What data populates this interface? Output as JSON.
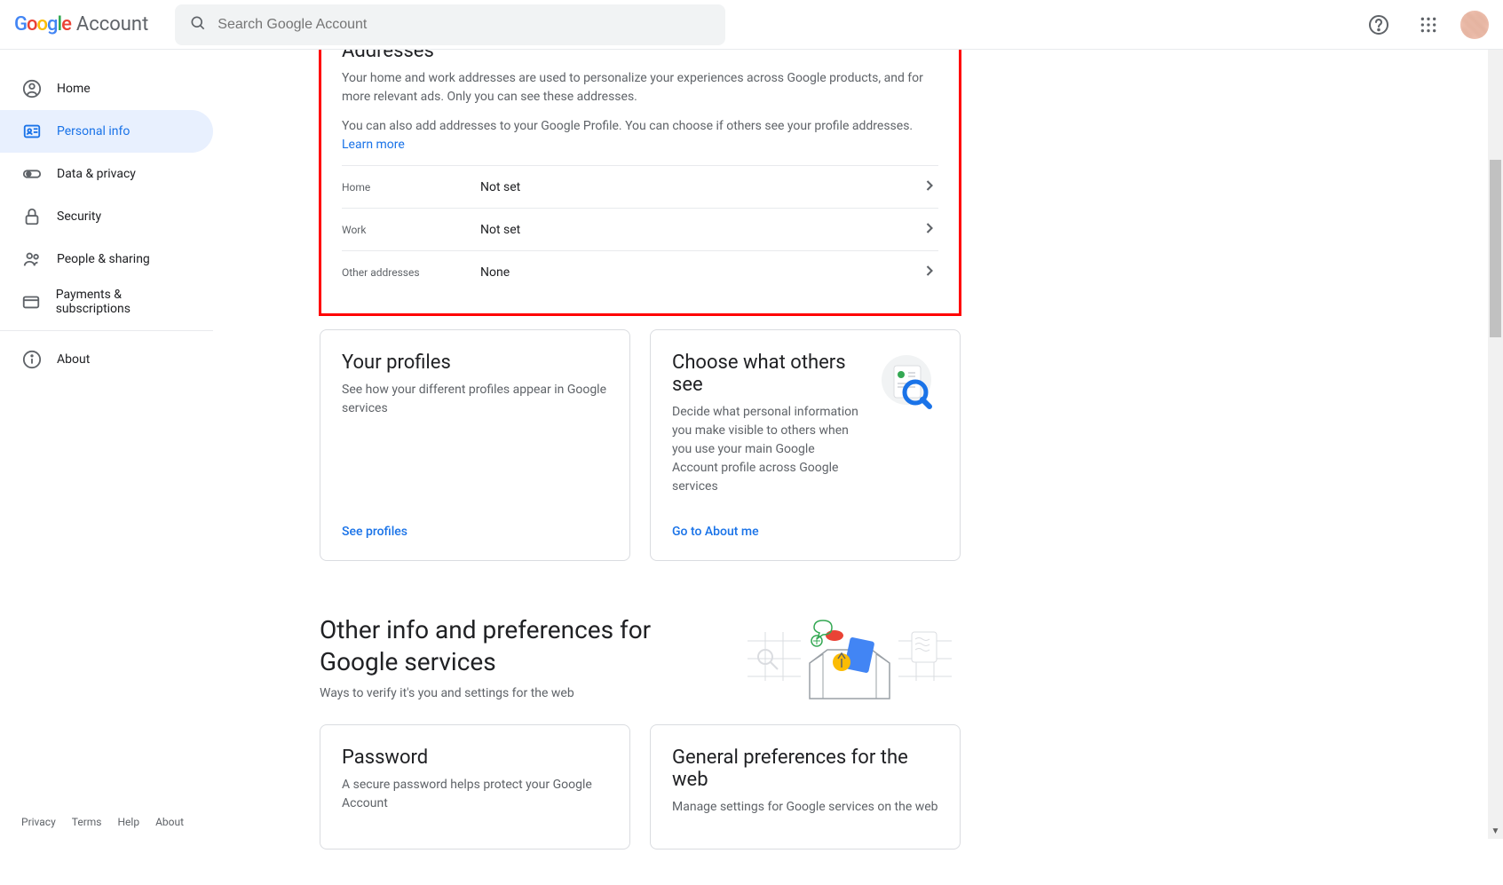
{
  "header": {
    "logo_brand": "Google",
    "logo_product": "Account",
    "search_placeholder": "Search Google Account"
  },
  "sidebar": {
    "items": [
      {
        "label": "Home"
      },
      {
        "label": "Personal info"
      },
      {
        "label": "Data & privacy"
      },
      {
        "label": "Security"
      },
      {
        "label": "People & sharing"
      },
      {
        "label": "Payments & subscriptions"
      },
      {
        "label": "About"
      }
    ]
  },
  "footer": {
    "links": [
      "Privacy",
      "Terms",
      "Help",
      "About"
    ]
  },
  "addresses_card": {
    "title": "Addresses",
    "desc1": "Your home and work addresses are used to personalize your experiences across Google products, and for more relevant ads. Only you can see these addresses.",
    "desc2": "You can also add addresses to your Google Profile. You can choose if others see your profile addresses. ",
    "learn_more": "Learn more",
    "rows": [
      {
        "label": "Home",
        "value": "Not set"
      },
      {
        "label": "Work",
        "value": "Not set"
      },
      {
        "label": "Other addresses",
        "value": "None"
      }
    ]
  },
  "profiles_card": {
    "title": "Your profiles",
    "desc": "See how your different profiles appear in Google services",
    "link": "See profiles"
  },
  "others_card": {
    "title": "Choose what others see",
    "desc": "Decide what personal information you make visible to others when you use your main Google Account profile across Google services",
    "link": "Go to About me"
  },
  "other_info_section": {
    "title": "Other info and preferences for Google services",
    "subtitle": "Ways to verify it's you and settings for the web"
  },
  "password_card": {
    "title": "Password",
    "desc": "A secure password helps protect your Google Account"
  },
  "general_prefs_card": {
    "title": "General preferences for the web",
    "desc": "Manage settings for Google services on the web"
  }
}
